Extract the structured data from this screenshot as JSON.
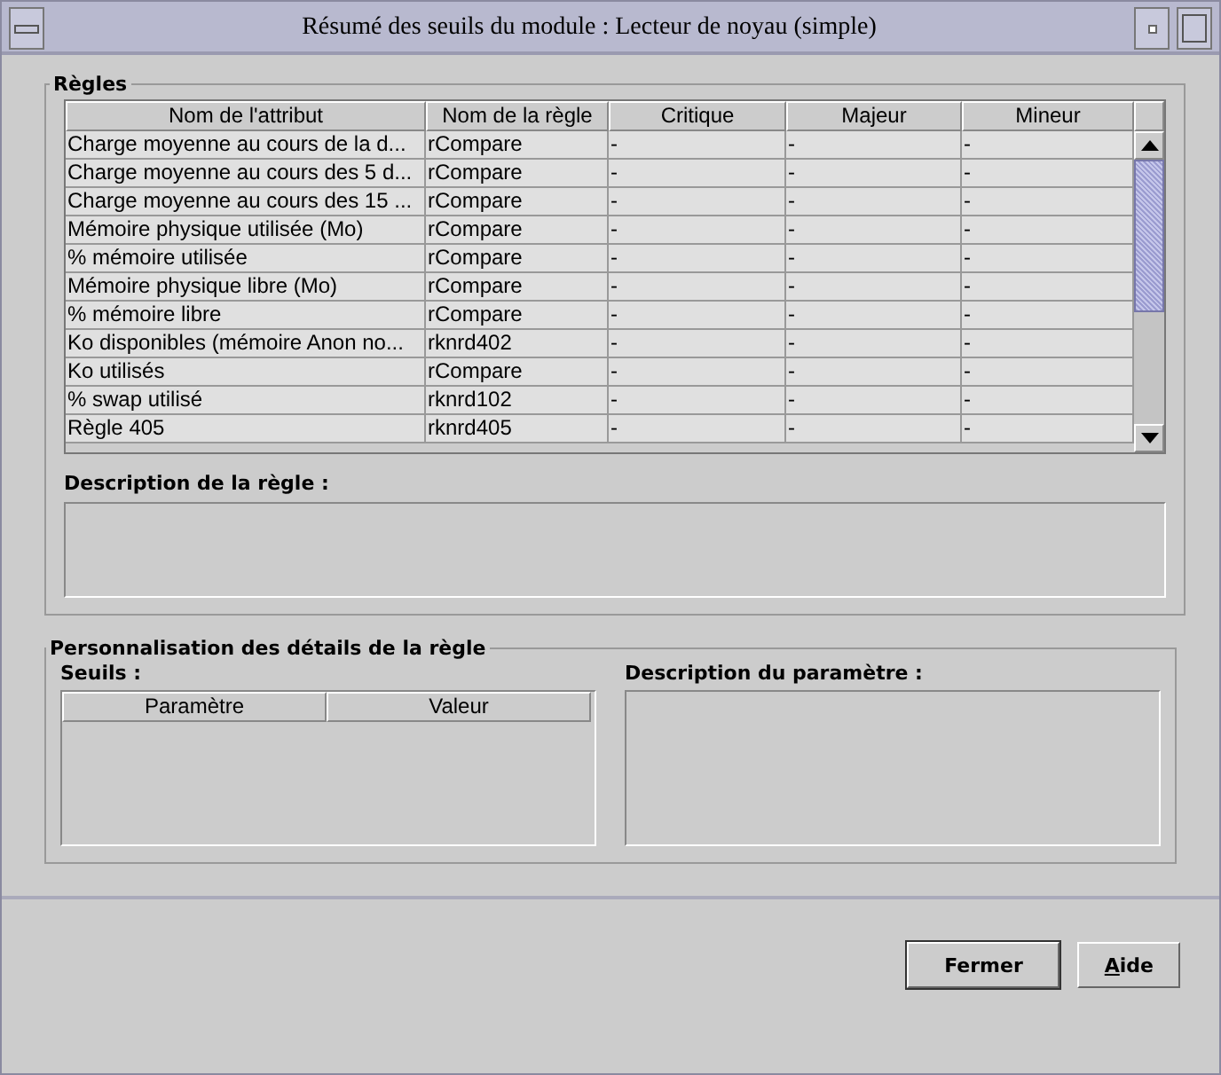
{
  "window": {
    "title": "Résumé des seuils du module : Lecteur de noyau (simple)"
  },
  "rules": {
    "legend": "Règles",
    "columns": [
      "Nom de l'attribut",
      "Nom de la règle",
      "Critique",
      "Majeur",
      "Mineur"
    ],
    "rows": [
      [
        "Charge moyenne au cours de la d...",
        "rCompare",
        "-",
        "-",
        "-"
      ],
      [
        "Charge moyenne au cours des 5 d...",
        "rCompare",
        "-",
        "-",
        "-"
      ],
      [
        "Charge moyenne au cours des 15 ...",
        "rCompare",
        "-",
        "-",
        "-"
      ],
      [
        "Mémoire physique utilisée (Mo)",
        "rCompare",
        "-",
        "-",
        "-"
      ],
      [
        "% mémoire utilisée",
        "rCompare",
        "-",
        "-",
        "-"
      ],
      [
        "Mémoire physique libre (Mo)",
        "rCompare",
        "-",
        "-",
        "-"
      ],
      [
        "% mémoire libre",
        "rCompare",
        "-",
        "-",
        "-"
      ],
      [
        "Ko disponibles (mémoire Anon no...",
        "rknrd402",
        "-",
        "-",
        "-"
      ],
      [
        "Ko utilisés",
        "rCompare",
        "-",
        "-",
        "-"
      ],
      [
        "% swap utilisé",
        "rknrd102",
        "-",
        "-",
        "-"
      ],
      [
        "Règle 405",
        "rknrd405",
        "-",
        "-",
        "-"
      ]
    ],
    "description_label": "Description de la règle :"
  },
  "customize": {
    "legend": "Personnalisation des détails de la règle",
    "thresholds_label": "Seuils :",
    "columns": [
      "Paramètre",
      "Valeur"
    ],
    "param_description_label": "Description du paramètre :"
  },
  "buttons": [
    {
      "label": "Fermer",
      "default": true,
      "underline_first": false
    },
    {
      "label": "Aide",
      "default": false,
      "underline_first": true
    }
  ]
}
